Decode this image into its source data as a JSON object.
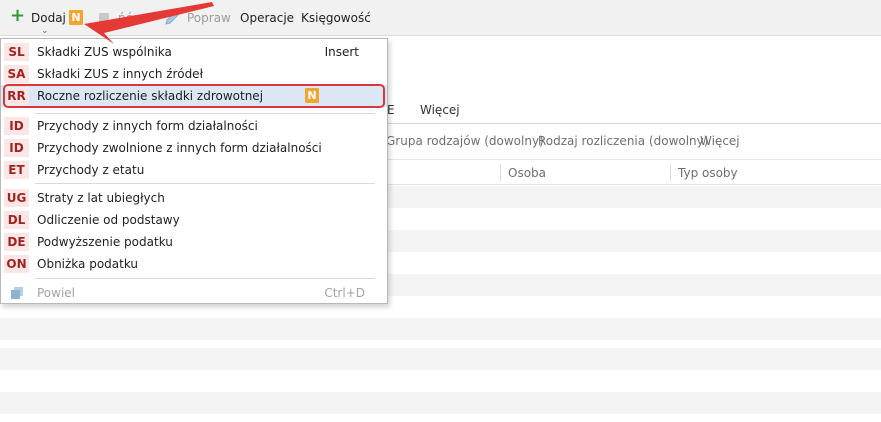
{
  "toolbar": {
    "add_label": "Dodaj",
    "badge": "N",
    "hidden_label": "ńć",
    "edit_label": "Popraw",
    "operations_label": "Operacje",
    "accounting_label": "Księgowość"
  },
  "tabs": {
    "left_partial": "E",
    "more": "Więcej"
  },
  "filters": {
    "group": "Grupa rodzajów (dowolny)",
    "kind": "Rodzaj rozliczenia (dowolny)",
    "more": "Więcej"
  },
  "grid": {
    "col_person": "Osoba",
    "col_person_type": "Typ osoby"
  },
  "menu": {
    "items": [
      {
        "abbr": "SL",
        "label": "Składki ZUS wspólnika",
        "shortcut": "Insert"
      },
      {
        "abbr": "SA",
        "label": "Składki ZUS z innych źródeł"
      },
      {
        "abbr": "RR",
        "label": "Roczne rozliczenie składki zdrowotnej",
        "badge": "N"
      },
      {
        "abbr": "ID",
        "label": "Przychody z innych form działalności"
      },
      {
        "abbr": "ID",
        "label": "Przychody zwolnione z innych form działalności"
      },
      {
        "abbr": "ET",
        "label": "Przychody z etatu"
      },
      {
        "abbr": "UG",
        "label": "Straty z lat ubiegłych"
      },
      {
        "abbr": "DL",
        "label": "Odliczenie od podstawy"
      },
      {
        "abbr": "DE",
        "label": "Podwyższenie podatku"
      },
      {
        "abbr": "ON",
        "label": "Obniżka podatku"
      }
    ],
    "copy": {
      "label": "Powiel",
      "shortcut": "Ctrl+D"
    }
  },
  "colors": {
    "accent_badge": "#f0a631",
    "abbr_text": "#a12323",
    "abbr_bg": "#fbe6e6",
    "highlight_bg": "#dbe7f5",
    "highlight_frame": "#d9363e",
    "arrow": "#e53935",
    "add_icon": "#2e9b2e"
  },
  "icons": [
    "plus-icon",
    "chevron-down-icon",
    "pencil-icon",
    "copy-icon",
    "annotation-arrow-icon"
  ]
}
